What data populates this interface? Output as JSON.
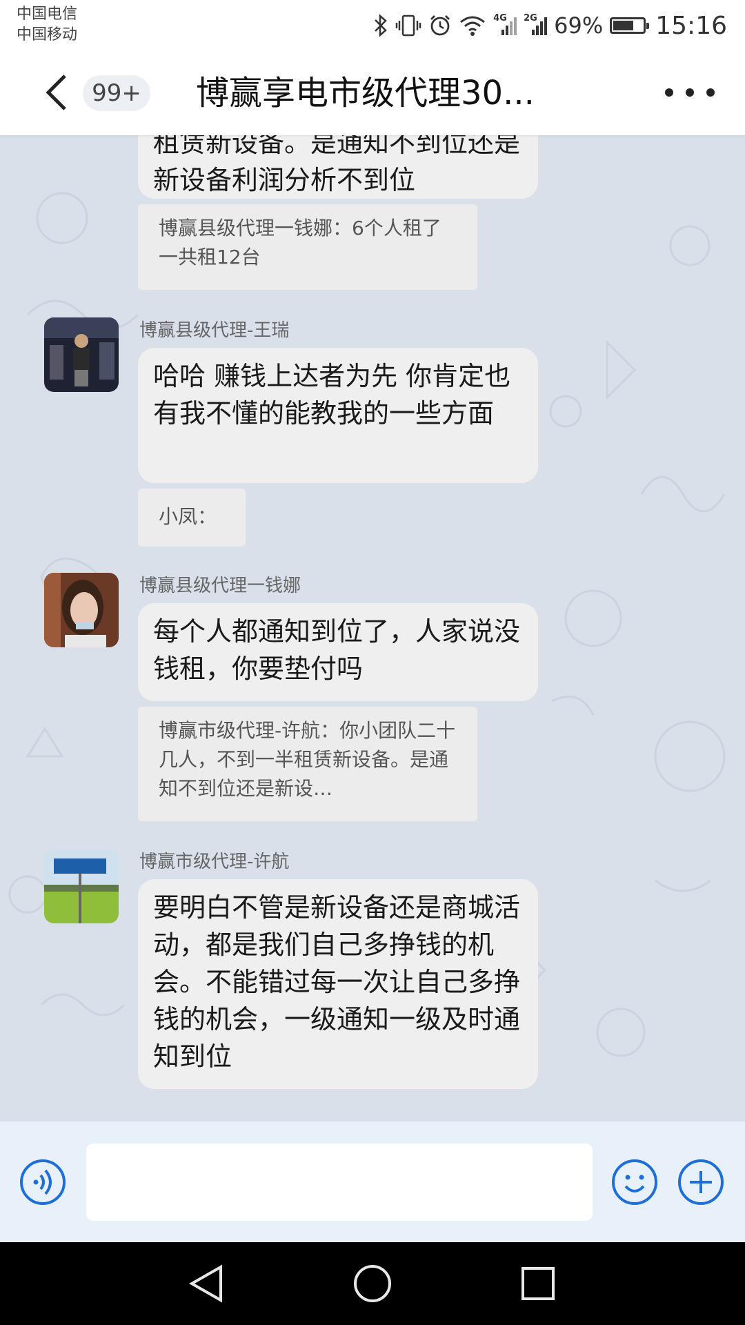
{
  "status_bar": {
    "carrier_1": "中国电信",
    "carrier_2": "中国移动",
    "signal_1_type": "4G",
    "signal_2_type": "2G",
    "battery_percent_text": "69%",
    "battery_level": 0.69,
    "time": "15:16",
    "icons": [
      "bluetooth-icon",
      "vibrate-icon",
      "alarm-icon",
      "wifi-icon",
      "signal-icon",
      "battery-charging-icon"
    ]
  },
  "header": {
    "unread_badge": "99+",
    "title": "博赢享电市级代理30..."
  },
  "messages": {
    "partial_bubble_text": "租赁新设备。是通知不到位还是新设备利润分析不到位",
    "quote_1": "博赢县级代理一钱娜：6个人租了一共租12台",
    "sender_1": "博赢县级代理-王瑞",
    "bubble_1": "哈哈  赚钱上达者为先  你肯定也有我不懂的能教我的一些方面",
    "quote_2": "小凤：",
    "sender_2": "博赢县级代理一钱娜",
    "bubble_2": "每个人都通知到位了，人家说没钱租，你要垫付吗",
    "quote_3": "博赢市级代理-许航：你小团队二十几人，不到一半租赁新设备。是通知不到位还是新设…",
    "sender_3": "博赢市级代理-许航",
    "bubble_3": "要明白不管是新设备还是商城活动，都是我们自己多挣钱的机会。不能错过每一次让自己多挣钱的机会，一级通知一级及时通知到位"
  },
  "input_bar": {
    "placeholder": "",
    "icons": [
      "voice-icon",
      "emoji-icon",
      "plus-icon"
    ]
  },
  "system_nav": {
    "icons": [
      "back-triangle-icon",
      "home-circle-icon",
      "recents-square-icon"
    ]
  },
  "colors": {
    "chat_background": "#d9e0ea",
    "bubble": "#efefef",
    "accent_blue": "#1f6fd8",
    "header_bg": "#ffffff"
  }
}
